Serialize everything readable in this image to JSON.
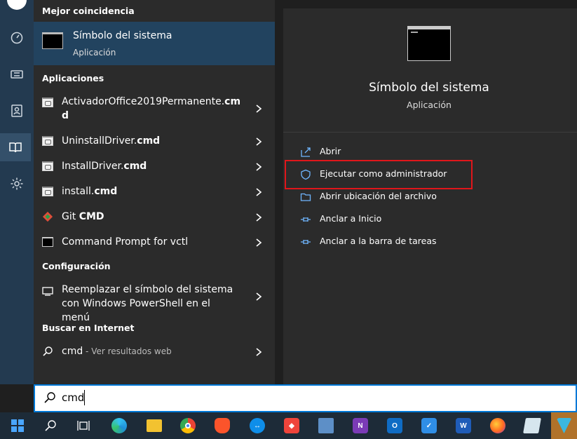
{
  "results": {
    "best_match_header": "Mejor coincidencia",
    "best_match": {
      "title": "Símbolo del sistema",
      "subtitle": "Aplicación"
    },
    "apps_header": "Aplicaciones",
    "apps": [
      {
        "label_line1": "ActivadorOffice2019Permanente.",
        "label_bold1": "cm",
        "label_line2_bold": "d",
        "icon": "cmd-file-icon"
      },
      {
        "label": "UninstallDriver.",
        "label_bold": "cmd",
        "icon": "cmd-file-icon"
      },
      {
        "label": "InstallDriver.",
        "label_bold": "cmd",
        "icon": "cmd-file-icon"
      },
      {
        "label": "install.",
        "label_bold": "cmd",
        "icon": "cmd-file-icon"
      },
      {
        "label": "Git ",
        "label_bold": "CMD",
        "icon": "git-icon"
      },
      {
        "label": "Command Prompt for vctl",
        "label_bold": "",
        "icon": "console-icon"
      }
    ],
    "settings_header": "Configuración",
    "settings": [
      {
        "line1": "Reemplazar el símbolo del sistema",
        "line2": "con Windows PowerShell en el menú"
      }
    ],
    "web_header": "Buscar en Internet",
    "web": {
      "query": "cmd",
      "suffix": " - Ver resultados web"
    }
  },
  "detail": {
    "title": "Símbolo del sistema",
    "subtitle": "Aplicación",
    "actions": [
      {
        "label": "Abrir",
        "icon": "open-icon"
      },
      {
        "label": "Ejecutar como administrador",
        "icon": "shield-icon"
      },
      {
        "label": "Abrir ubicación del archivo",
        "icon": "folder-icon"
      },
      {
        "label": "Anclar a Inicio",
        "icon": "pin-icon"
      },
      {
        "label": "Anclar a la barra de tareas",
        "icon": "pin-icon"
      }
    ]
  },
  "search": {
    "value": "cmd"
  },
  "taskbar": {
    "apps": [
      "start",
      "search",
      "task-view",
      "edge",
      "file-explorer",
      "chrome",
      "brave",
      "teamviewer",
      "anydesk",
      "remote-desktop",
      "onenote",
      "outlook",
      "todo",
      "word",
      "firefox",
      "notepad",
      "vmware"
    ],
    "badges": {
      "onenote": "N",
      "outlook": "O",
      "word": "W"
    }
  },
  "colors": {
    "accent": "#0078d7",
    "highlight_box": "#e0161b",
    "selected_row": "#22435f"
  }
}
